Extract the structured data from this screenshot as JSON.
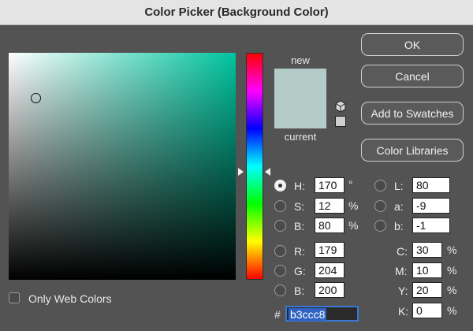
{
  "window": {
    "title": "Color Picker (Background Color)"
  },
  "swatches": {
    "new_label": "new",
    "current_label": "current",
    "new_color": "#b3ccc8",
    "current_color": "#b3ccc8"
  },
  "buttons": {
    "ok": "OK",
    "cancel": "Cancel",
    "add_to_swatches": "Add to Swatches",
    "color_libraries": "Color Libraries"
  },
  "hsb": {
    "h": {
      "label": "H:",
      "value": "170",
      "unit": "°",
      "selected": true
    },
    "s": {
      "label": "S:",
      "value": "12",
      "unit": "%"
    },
    "b": {
      "label": "B:",
      "value": "80",
      "unit": "%"
    }
  },
  "rgb": {
    "r": {
      "label": "R:",
      "value": "179"
    },
    "g": {
      "label": "G:",
      "value": "204"
    },
    "b": {
      "label": "B:",
      "value": "200"
    }
  },
  "lab": {
    "l": {
      "label": "L:",
      "value": "80"
    },
    "a": {
      "label": "a:",
      "value": "-9"
    },
    "b": {
      "label": "b:",
      "value": "-1"
    }
  },
  "cmyk": {
    "c": {
      "label": "C:",
      "value": "30",
      "unit": "%"
    },
    "m": {
      "label": "M:",
      "value": "10",
      "unit": "%"
    },
    "y": {
      "label": "Y:",
      "value": "20",
      "unit": "%"
    },
    "k": {
      "label": "K:",
      "value": "0",
      "unit": "%"
    }
  },
  "hex": {
    "label": "#",
    "value": "b3ccc8"
  },
  "only_web_colors": {
    "label": "Only Web Colors",
    "checked": false
  },
  "icons": {
    "gamut": "cube-icon"
  }
}
